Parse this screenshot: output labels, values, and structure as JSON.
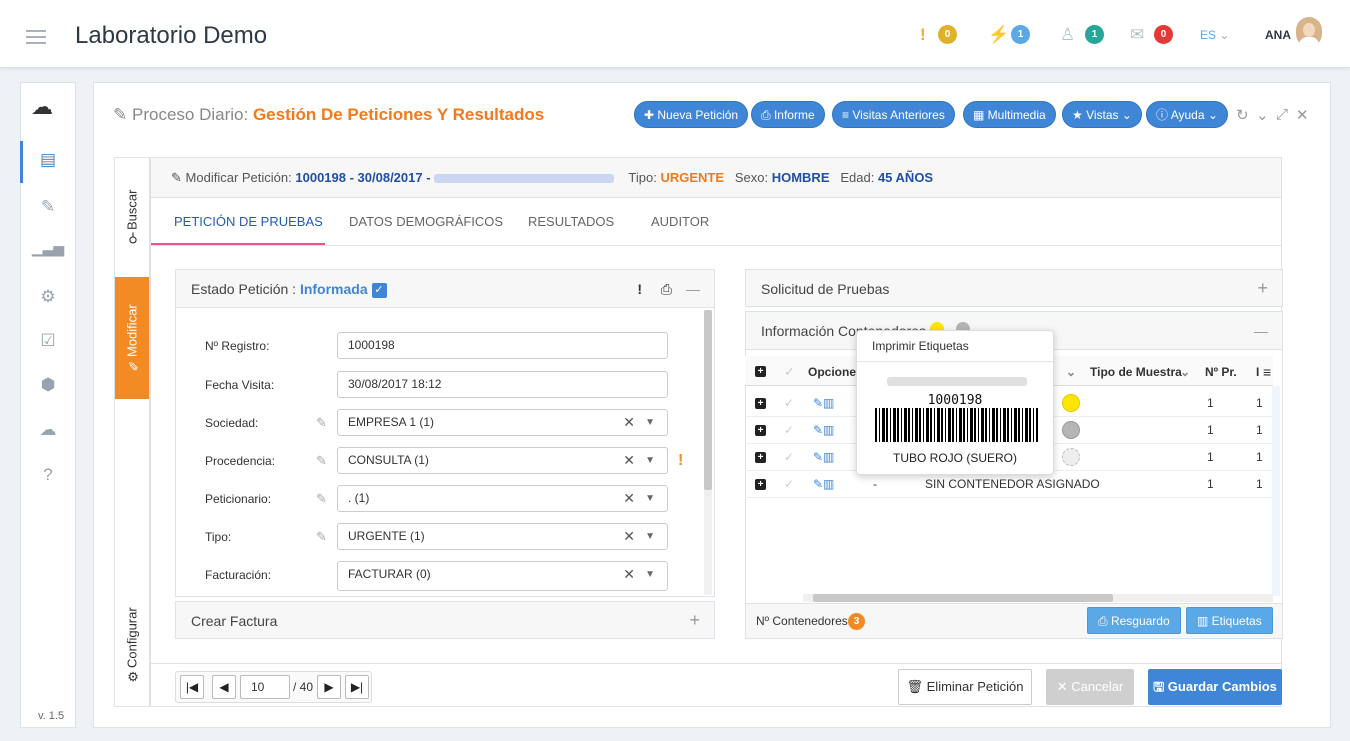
{
  "app": {
    "title": "Laboratorio Demo",
    "version": "v. 1.5"
  },
  "topbar": {
    "badges": [
      {
        "icon": "alert-icon",
        "count": "0",
        "color": "#e2b12a"
      },
      {
        "icon": "plug-icon",
        "count": "1",
        "color": "#5aa8e6"
      },
      {
        "icon": "users-icon",
        "count": "1",
        "color": "#26a69a"
      },
      {
        "icon": "inbox-icon",
        "count": "0",
        "color": "#e53935"
      }
    ],
    "language": "ES",
    "user": "ANA"
  },
  "sidebar": {
    "items": [
      "cloud-icon",
      "newspaper-icon",
      "wrench-icon",
      "bar-chart-icon",
      "gear-icon",
      "calendar-check-icon",
      "cube-icon",
      "cloud-solid-icon",
      "help-icon"
    ]
  },
  "header": {
    "title_prefix": "Proceso Diario:",
    "title_main": "Gestión De Peticiones Y Resultados",
    "buttons": [
      "Nueva Petición",
      "Informe",
      "Visitas Anteriores",
      "Multimedia",
      "Vistas",
      "Ayuda"
    ]
  },
  "vertical_tabs": {
    "search": "Buscar",
    "modify": "Modificar",
    "configure": "Configurar"
  },
  "modify_bar": {
    "label": "Modificar Petición:",
    "request": "1000198 - 30/08/2017 -",
    "tipo_label": "Tipo:",
    "tipo": "URGENTE",
    "sexo_label": "Sexo:",
    "sexo": "HOMBRE",
    "edad_label": "Edad:",
    "edad": "45 AÑOS"
  },
  "tabs": [
    "PETICIÓN DE PRUEBAS",
    "DATOS DEMOGRÁFICOS",
    "RESULTADOS",
    "AUDITOR"
  ],
  "estado": {
    "label": "Estado Petición :",
    "value": "Informada"
  },
  "form": [
    {
      "label": "Nº Registro:",
      "value": "1000198"
    },
    {
      "label": "Fecha Visita:",
      "value": "30/08/2017 18:12"
    },
    {
      "label": "Sociedad:",
      "value": "EMPRESA 1 (1)"
    },
    {
      "label": "Procedencia:",
      "value": "CONSULTA (1)"
    },
    {
      "label": "Peticionario:",
      "value": ". (1)"
    },
    {
      "label": "Tipo:",
      "value": "URGENTE (1)"
    },
    {
      "label": "Facturación:",
      "value": "FACTURAR (0)"
    }
  ],
  "crear_factura": "Crear Factura",
  "solicitud": "Solicitud de Pruebas",
  "info_contenedores": "Información Contenedores",
  "table": {
    "headers": [
      "Opciones",
      "Tipo de Muestra",
      "Nº Pr.",
      "I"
    ],
    "rows": [
      {
        "dash": "",
        "name": "",
        "n1": "1",
        "n2": "1"
      },
      {
        "dash": "",
        "name": "",
        "n1": "1",
        "n2": "1"
      },
      {
        "dash": "",
        "name": "",
        "n1": "1",
        "n2": "1"
      },
      {
        "dash": "-",
        "name": "SIN CONTENEDOR ASIGNADO",
        "n1": "1",
        "n2": "1"
      }
    ]
  },
  "footer_right": {
    "count_label": "Nº Contenedores:",
    "count": "3",
    "resguardo": "Resguardo",
    "etiquetas": "Etiquetas"
  },
  "tooltip": {
    "title": "Imprimir Etiquetas",
    "code": "1000198",
    "tube": "TUBO ROJO (SUERO)"
  },
  "pager": {
    "page": "10",
    "total": "/ 40"
  },
  "actions": {
    "delete": "Eliminar Petición",
    "cancel": "Cancelar",
    "save": "Guardar Cambios"
  }
}
